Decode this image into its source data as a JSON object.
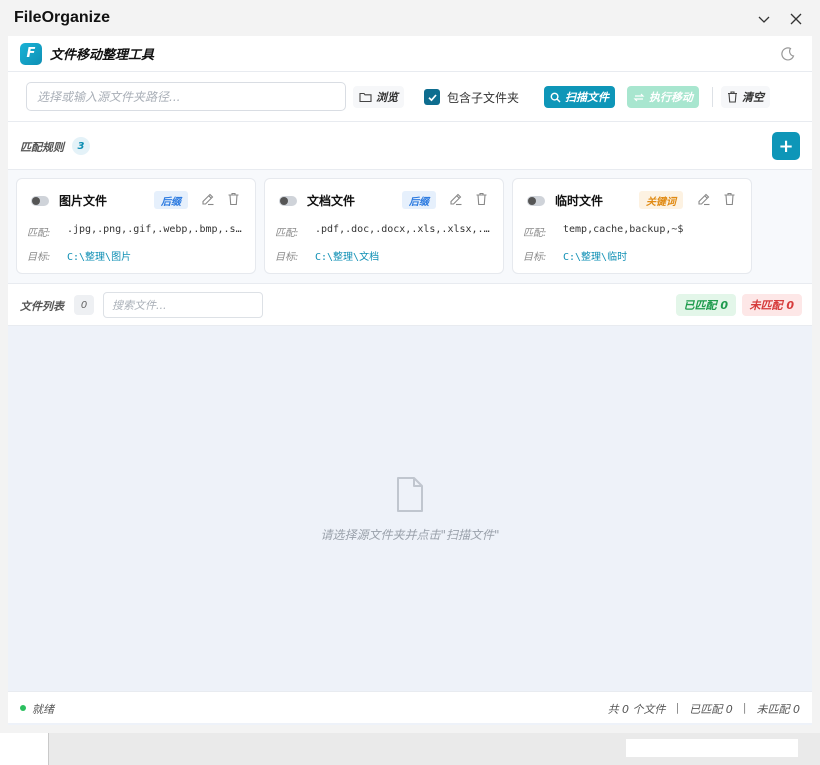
{
  "window": {
    "title": "FileOrganize"
  },
  "header": {
    "logo_letter": "F",
    "title": "文件移动整理工具"
  },
  "toolbar": {
    "path_placeholder": "选择或输入源文件夹路径...",
    "browse_label": "浏览",
    "include_subfolders_label": "包含子文件夹",
    "include_subfolders_checked": true,
    "scan_label": "扫描文件",
    "move_label": "执行移动",
    "clear_label": "清空"
  },
  "rules": {
    "label": "匹配规则",
    "count": "3",
    "add_label": "+",
    "match_key": "匹配:",
    "target_key": "目标:",
    "items": [
      {
        "name": "图片文件",
        "type": "后缀",
        "type_kind": "suffix",
        "match": ".jpg,.png,.gif,.webp,.bmp,.svg",
        "target": "C:\\整理\\图片"
      },
      {
        "name": "文档文件",
        "type": "后缀",
        "type_kind": "suffix",
        "match": ".pdf,.doc,.docx,.xls,.xlsx,.ppt",
        "target": "C:\\整理\\文档"
      },
      {
        "name": "临时文件",
        "type": "关键词",
        "type_kind": "keyword",
        "match": "temp,cache,backup,~$",
        "target": "C:\\整理\\临时"
      }
    ]
  },
  "files": {
    "label": "文件列表",
    "count": "0",
    "search_placeholder": "搜索文件...",
    "matched_pill": "已匹配 0",
    "unmatched_pill": "未匹配 0",
    "empty_text": "请选择源文件夹并点击\"扫描文件\""
  },
  "status": {
    "text": "就绪",
    "total": "共 0 个文件",
    "sep": "|",
    "matched": "已匹配 0",
    "unmatched": "未匹配 0"
  },
  "colors": {
    "accent": "#0e96b8",
    "success": "#1e9b4d",
    "danger": "#d63a3a",
    "warning": "#e08a13"
  }
}
